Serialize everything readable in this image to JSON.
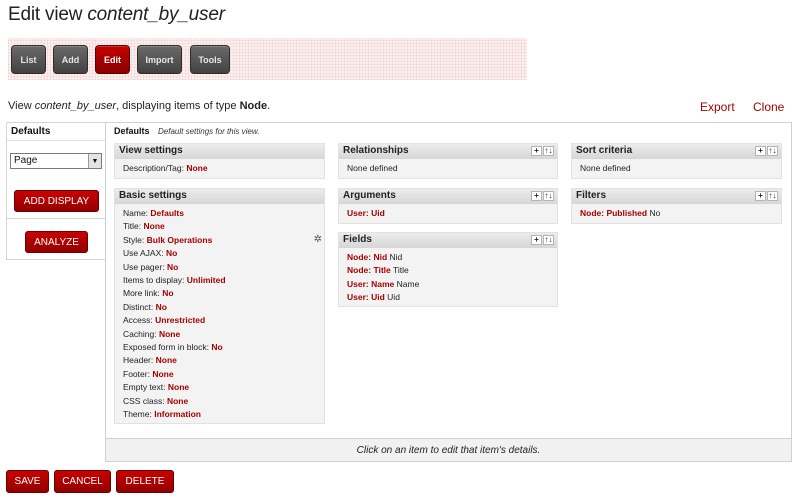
{
  "page": {
    "title_prefix": "Edit view",
    "title_name": "content_by_user"
  },
  "tabs": [
    {
      "label": "List"
    },
    {
      "label": "Add"
    },
    {
      "label": "Edit"
    },
    {
      "label": "Import"
    },
    {
      "label": "Tools"
    }
  ],
  "info": {
    "prefix": "View",
    "view_name": "content_by_user",
    "middle": ", displaying items of type",
    "type": "Node",
    "suffix": "."
  },
  "links": {
    "export": "Export",
    "clone": "Clone"
  },
  "left": {
    "display_tab": "Defaults",
    "arrow": "▶",
    "select_value": "Page",
    "select_arrow": "▼",
    "add_display": "ADD DISPLAY",
    "analyze": "ANALYZE"
  },
  "defaults_header": {
    "title": "Defaults",
    "desc": "Default settings for this view."
  },
  "view_settings": {
    "title": "View settings",
    "rows": [
      {
        "label": "Description/Tag:",
        "value": "None"
      }
    ]
  },
  "basic_settings": {
    "title": "Basic settings",
    "rows": [
      {
        "label": "Name:",
        "value": "Defaults"
      },
      {
        "label": "Title:",
        "value": "None"
      },
      {
        "label": "Style:",
        "value": "Bulk Operations"
      },
      {
        "label": "Use AJAX:",
        "value": "No"
      },
      {
        "label": "Use pager:",
        "value": "No"
      },
      {
        "label": "Items to display:",
        "value": "Unlimited"
      },
      {
        "label": "More link:",
        "value": "No"
      },
      {
        "label": "Distinct:",
        "value": "No"
      },
      {
        "label": "Access:",
        "value": "Unrestricted"
      },
      {
        "label": "Caching:",
        "value": "None"
      },
      {
        "label": "Exposed form in block:",
        "value": "No"
      },
      {
        "label": "Header:",
        "value": "None"
      },
      {
        "label": "Footer:",
        "value": "None"
      },
      {
        "label": "Empty text:",
        "value": "None"
      },
      {
        "label": "CSS class:",
        "value": "None"
      },
      {
        "label": "Theme:",
        "value": "Information"
      }
    ]
  },
  "relationships": {
    "title": "Relationships",
    "empty": "None defined"
  },
  "arguments": {
    "title": "Arguments",
    "items": [
      {
        "name": "User: Uid",
        "rest": ""
      }
    ]
  },
  "fields": {
    "title": "Fields",
    "items": [
      {
        "name": "Node: Nid",
        "rest": "Nid"
      },
      {
        "name": "Node: Title",
        "rest": "Title"
      },
      {
        "name": "User: Name",
        "rest": "Name"
      },
      {
        "name": "User: Uid",
        "rest": "Uid"
      }
    ]
  },
  "sort_criteria": {
    "title": "Sort criteria",
    "empty": "None defined"
  },
  "filters": {
    "title": "Filters",
    "items": [
      {
        "name": "Node: Published",
        "rest": "No"
      }
    ]
  },
  "icons": {
    "add": "+",
    "rearrange": "↑↓",
    "gear": "✲"
  },
  "footer": {
    "hint": "Click on an item to edit that item's details."
  },
  "buttons": {
    "save": "SAVE",
    "cancel": "CANCEL",
    "delete": "DELETE"
  }
}
